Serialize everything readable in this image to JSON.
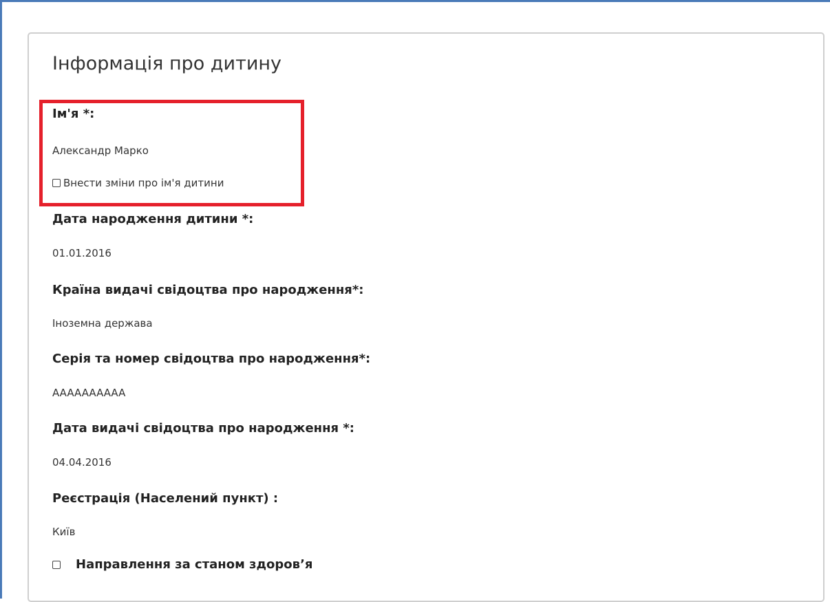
{
  "section": {
    "title": "Інформація про дитину"
  },
  "fields": {
    "name": {
      "label": "Ім'я *:",
      "value": "Александр Марко",
      "change_checkbox_label": "Внести зміни про ім'я дитини",
      "change_checked": false
    },
    "birth_date": {
      "label": "Дата народження дитини *:",
      "value": "01.01.2016"
    },
    "certificate_country": {
      "label": "Країна видачі свідоцтва про народження*:",
      "value": "Іноземна держава"
    },
    "certificate_number": {
      "label": "Серія та номер свідоцтва про народження*:",
      "value": "AAAAAAAAAA"
    },
    "certificate_date": {
      "label": "Дата видачі свідоцтва про народження *:",
      "value": "04.04.2016"
    },
    "registration": {
      "label": "Реєстрація (Населений пункт) :",
      "value": "Київ"
    },
    "health_referral": {
      "label": "Направлення за станом здоров’я",
      "checked": false
    }
  },
  "colors": {
    "highlight_border": "#e5202b",
    "frame_accent": "#4a7ab8",
    "card_border": "#cfcfcf"
  }
}
